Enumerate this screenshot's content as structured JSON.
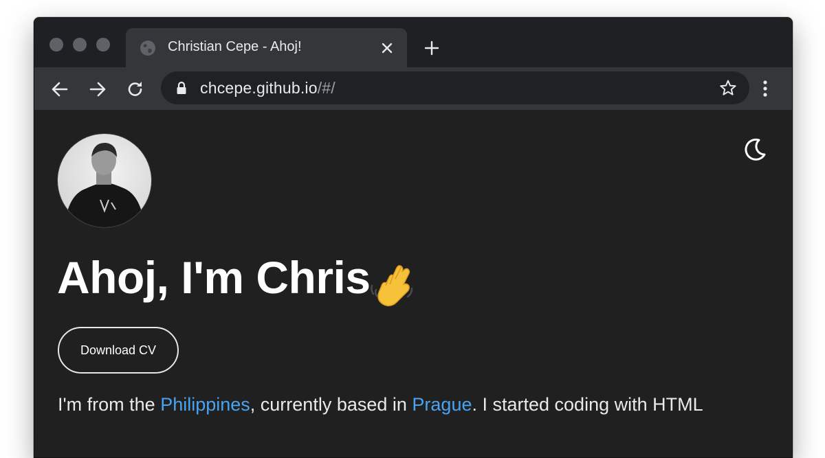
{
  "browser": {
    "tab": {
      "title": "Christian Cepe - Ahoj!",
      "favicon": "globe-icon"
    },
    "address_bar": {
      "host": "chcepe.github.io",
      "path": "/#/"
    },
    "icons": {
      "back": "arrow-left-icon",
      "forward": "arrow-right-icon",
      "reload": "reload-icon",
      "bookmark": "star-icon",
      "menu": "kebab-menu-icon",
      "new_tab": "plus-icon",
      "close_tab": "close-icon"
    }
  },
  "page": {
    "greeting": "Ahoj, I'm Chris",
    "greeting_emoji": "waving-hand-icon",
    "download_cv_label": "Download CV",
    "theme_toggle_icon": "moon-icon",
    "intro": {
      "part1": "I'm from the ",
      "link1": "Philippines",
      "part2": ", currently based in ",
      "link2": "Prague",
      "part3": ". I started coding with HTML"
    }
  },
  "colors": {
    "page_background": "#202020",
    "link": "#4aa3f0",
    "toolbar": "#35363a",
    "titlebar": "#1f2023"
  }
}
